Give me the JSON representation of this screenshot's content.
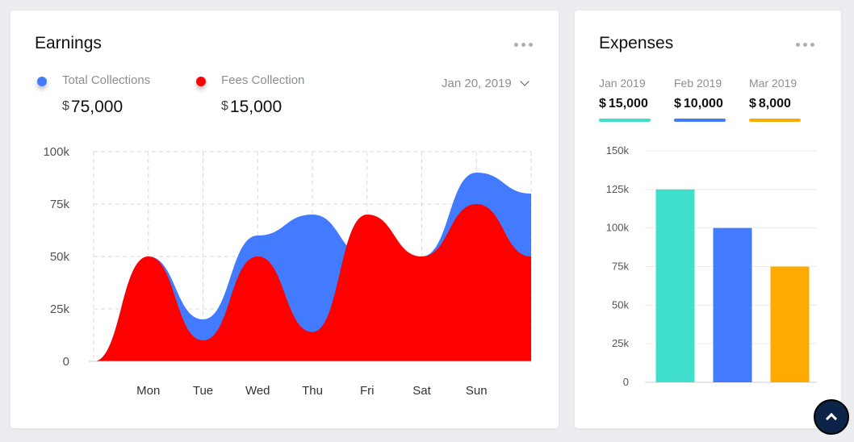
{
  "earnings": {
    "title": "Earnings",
    "legend": [
      {
        "label": "Total Collections",
        "currency": "$",
        "value": "75,000",
        "color": "#427bff"
      },
      {
        "label": "Fees Collection",
        "currency": "$",
        "value": "15,000",
        "color": "#ff0000"
      }
    ],
    "date": "Jan 20, 2019"
  },
  "expenses": {
    "title": "Expenses",
    "months": [
      {
        "month": "Jan 2019",
        "currency": "$",
        "value": "15,000",
        "color": "#40dfcd"
      },
      {
        "month": "Feb 2019",
        "currency": "$",
        "value": "10,000",
        "color": "#427bff"
      },
      {
        "month": "Mar 2019",
        "currency": "$",
        "value": "8,000",
        "color": "#ffaa00"
      }
    ]
  },
  "chart_data": [
    {
      "type": "area",
      "categories": [
        "Mon",
        "Tue",
        "Wed",
        "Thu",
        "Fri",
        "Sat",
        "Sun"
      ],
      "y_tick_labels": [
        "0",
        "25k",
        "50k",
        "75k",
        "100k"
      ],
      "ylim": [
        0,
        100000
      ],
      "grid": true,
      "series": [
        {
          "name": "Total Collections",
          "color": "#427bff",
          "x": [
            0,
            1,
            2,
            3,
            4,
            5,
            6,
            7,
            8
          ],
          "values": [
            0,
            50000,
            20000,
            60000,
            70000,
            50000,
            50000,
            90000,
            80000
          ]
        },
        {
          "name": "Fees Collection",
          "color": "#ff0000",
          "x": [
            0,
            1,
            2,
            3,
            4,
            5,
            6,
            7,
            8
          ],
          "values": [
            0,
            50000,
            10000,
            50000,
            14000,
            70000,
            50000,
            75000,
            50000
          ]
        }
      ]
    },
    {
      "type": "bar",
      "categories": [
        "Jan 2019",
        "Feb 2019",
        "Mar 2019"
      ],
      "values": [
        125000,
        100000,
        75000
      ],
      "colors": [
        "#40dfcd",
        "#427bff",
        "#ffaa00"
      ],
      "y_tick_labels": [
        "0",
        "25k",
        "50k",
        "75k",
        "100k",
        "125k",
        "150k"
      ],
      "ylim": [
        0,
        150000
      ],
      "grid": true
    }
  ]
}
